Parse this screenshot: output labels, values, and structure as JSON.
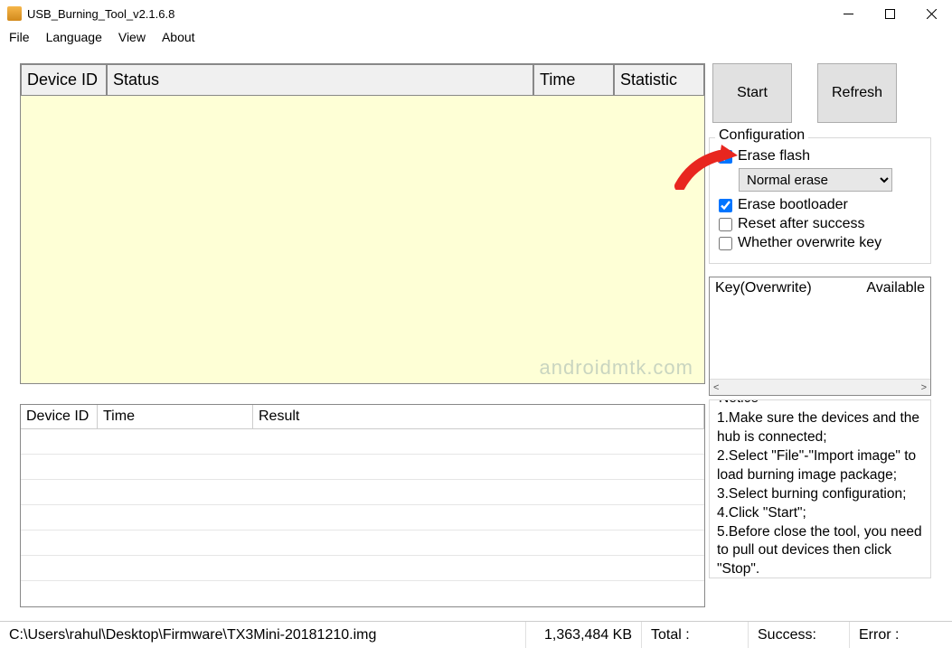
{
  "window": {
    "title": "USB_Burning_Tool_v2.1.6.8"
  },
  "menu": {
    "file": "File",
    "language": "Language",
    "view": "View",
    "about": "About"
  },
  "table1": {
    "cols": {
      "device_id": "Device ID",
      "status": "Status",
      "time": "Time",
      "statistic": "Statistic"
    }
  },
  "table2": {
    "cols": {
      "device_id": "Device ID",
      "time": "Time",
      "result": "Result"
    }
  },
  "buttons": {
    "start": "Start",
    "refresh": "Refresh"
  },
  "config": {
    "legend": "Configuration",
    "erase_flash": "Erase flash",
    "erase_flash_checked": true,
    "erase_mode": "Normal erase",
    "erase_bootloader": "Erase bootloader",
    "erase_bootloader_checked": true,
    "reset_after": "Reset after success",
    "reset_after_checked": false,
    "overwrite_key": "Whether overwrite key",
    "overwrite_key_checked": false
  },
  "keytable": {
    "col1": "Key(Overwrite)",
    "col2": "Available"
  },
  "notice": {
    "legend": "Notice",
    "lines": [
      "1.Make sure the devices and the hub is connected;",
      "2.Select \"File\"-\"Import image\" to load burning image package;",
      "3.Select burning configuration;",
      "4.Click \"Start\";",
      "5.Before close the tool, you need to pull out devices then click \"Stop\"."
    ]
  },
  "status": {
    "path": "C:\\Users\\rahul\\Desktop\\Firmware\\TX3Mini-20181210.img",
    "size": "1,363,484 KB",
    "total": "Total :",
    "success": "Success:",
    "error": "Error :"
  },
  "watermark": "androidmtk.com"
}
